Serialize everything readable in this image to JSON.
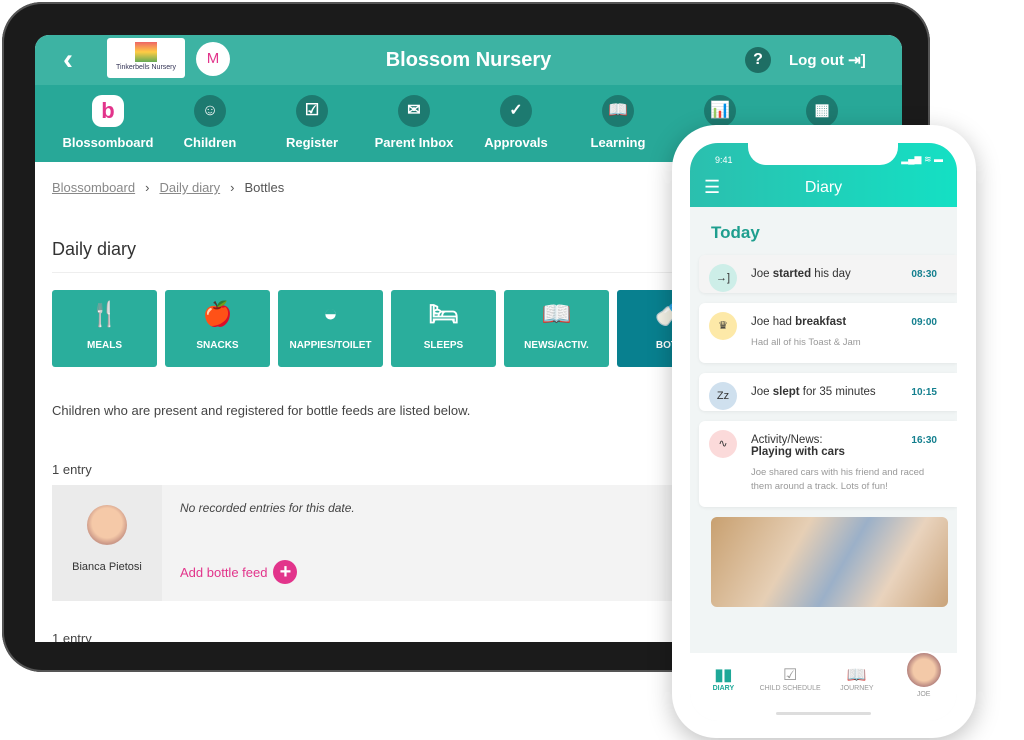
{
  "tablet": {
    "header": {
      "back_icon": "chevron-left-icon",
      "logo_text": "Tinkerbells Nursery",
      "user_initial": "M",
      "title": "Blossom Nursery",
      "help_label": "?",
      "logout_label": "Log out"
    },
    "nav": [
      {
        "label": "Blossomboard",
        "icon": "b"
      },
      {
        "label": "Children",
        "icon": "☺"
      },
      {
        "label": "Register",
        "icon": "☑"
      },
      {
        "label": "Parent Inbox",
        "icon": "✉"
      },
      {
        "label": "Approvals",
        "icon": "✓"
      },
      {
        "label": "Learning",
        "icon": "📖"
      },
      {
        "label": "",
        "icon": "📊"
      },
      {
        "label": "",
        "icon": "▦"
      }
    ],
    "breadcrumb": [
      "Blossomboard",
      "Daily diary",
      "Bottles"
    ],
    "page_title": "Daily diary",
    "tiles": [
      {
        "label": "MEALS",
        "icon": "🍴"
      },
      {
        "label": "SNACKS",
        "icon": "🍎"
      },
      {
        "label": "NAPPIES/TOILET",
        "icon": "◒"
      },
      {
        "label": "SLEEPS",
        "icon": "🛏"
      },
      {
        "label": "NEWS/ACTIV.",
        "icon": "📖"
      },
      {
        "label": "BOTT",
        "icon": "🍼",
        "active": true
      }
    ],
    "description": "Children who are present and registered for bottle feeds are listed below.",
    "entry_count": "1 entry",
    "child_name": "Bianca Pietosi",
    "no_entries": "No recorded entries for this date.",
    "add_label": "Add bottle feed",
    "entry_count_2": "1 entry"
  },
  "phone": {
    "time": "9:41",
    "status": "▂▄▆ ≋ ▬",
    "title": "Diary",
    "today": "Today",
    "items": [
      {
        "pre": "Joe ",
        "bold": "started",
        "post": " his day",
        "time": "08:30",
        "icon": "→]",
        "color": "#cdeee8"
      },
      {
        "pre": "Joe had ",
        "bold": "breakfast",
        "post": "",
        "time": "09:00",
        "sub": "Had all of his Toast & Jam",
        "icon": "♛",
        "color": "#fde9a8"
      },
      {
        "pre": "Joe ",
        "bold": "slept",
        "post": " for 35 minutes",
        "time": "10:15",
        "icon": "Zz",
        "color": "#cfe0ee"
      },
      {
        "pre": "Activity/News:",
        "bold": "Playing with cars",
        "post": "",
        "time": "16:30",
        "sub": "Joe shared cars with his friend and raced them around a track. Lots of fun!",
        "icon": "∿",
        "color": "#fbdada"
      }
    ],
    "tabs": [
      "DIARY",
      "CHILD SCHEDULE",
      "JOURNEY",
      "JOE"
    ]
  }
}
